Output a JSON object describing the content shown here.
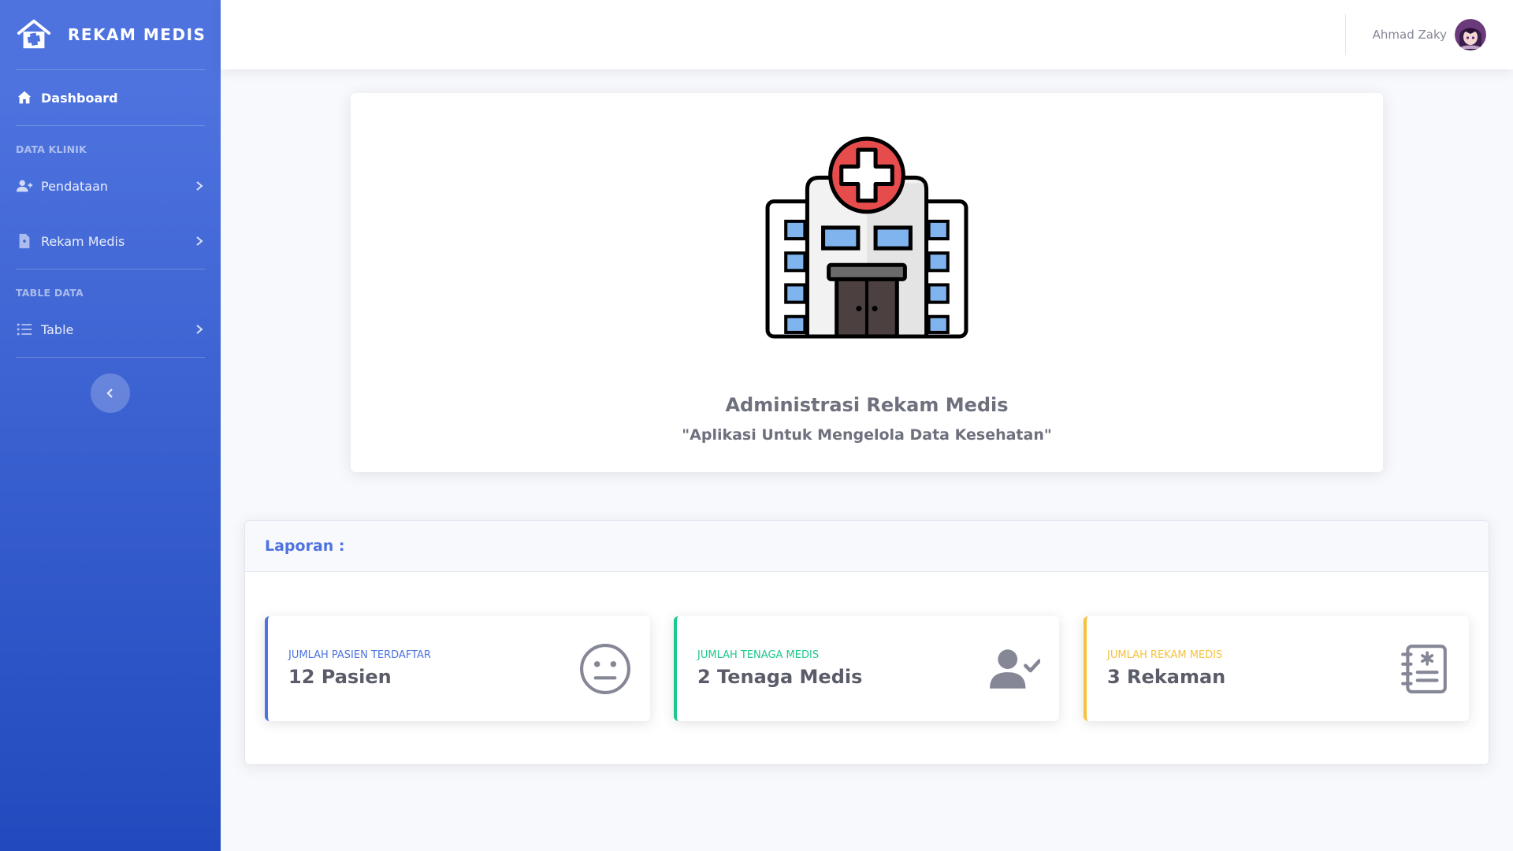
{
  "brand": {
    "title": "REKAM MEDIS"
  },
  "sidebar": {
    "dashboard_label": "Dashboard",
    "heading_data_klinik": "DATA KLINIK",
    "pendataan_label": "Pendataan",
    "rekam_medis_label": "Rekam Medis",
    "heading_table_data": "TABLE DATA",
    "table_label": "Table"
  },
  "topbar": {
    "user_name": "Ahmad Zaky"
  },
  "hero": {
    "title": "Administrasi Rekam Medis",
    "subtitle": "\"Aplikasi Untuk Mengelola Data Kesehatan\""
  },
  "report": {
    "title": "Laporan :",
    "cards": [
      {
        "label": "JUMLAH PASIEN TERDAFTAR",
        "value": "12 Pasien",
        "icon": "neutral-face-icon",
        "color": "#4e73df"
      },
      {
        "label": "JUMLAH TENAGA MEDIS",
        "value": "2 Tenaga Medis",
        "icon": "user-check-icon",
        "color": "#1cc88a"
      },
      {
        "label": "JUMLAH REKAM MEDIS",
        "value": "3 Rekaman",
        "icon": "medical-notebook-icon",
        "color": "#f6c23e"
      }
    ]
  },
  "colors": {
    "primary": "#4e73df",
    "success": "#1cc88a",
    "warning": "#f6c23e",
    "text_gray": "#5a5c69"
  }
}
